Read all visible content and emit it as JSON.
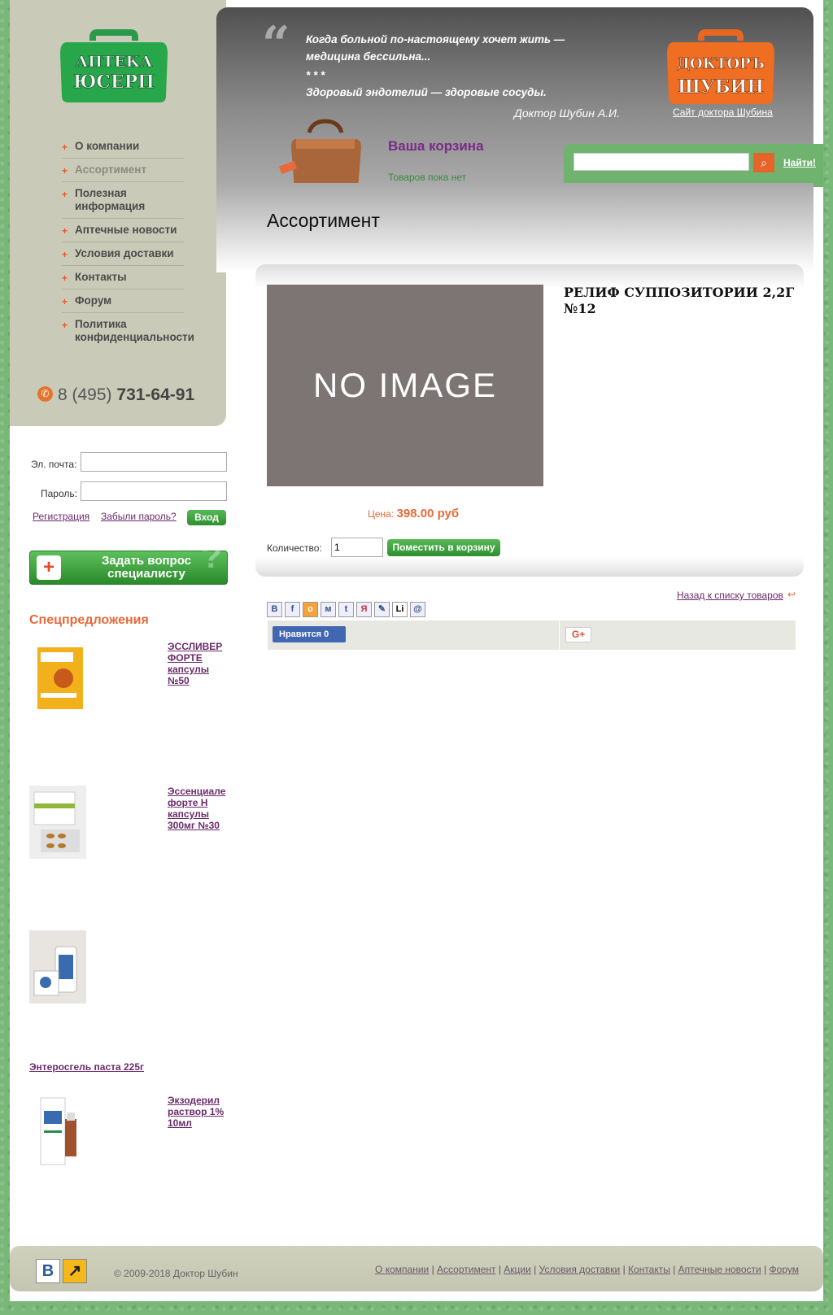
{
  "logo": {
    "line1": "АПТЕКА",
    "line2": "ЮСЕРП"
  },
  "nav": [
    {
      "label": "О компании",
      "active": false
    },
    {
      "label": "Ассортимент",
      "active": true
    },
    {
      "label": "Полезная информация",
      "active": false
    },
    {
      "label": "Аптечные новости",
      "active": false
    },
    {
      "label": "Условия доставки",
      "active": false
    },
    {
      "label": "Контакты",
      "active": false
    },
    {
      "label": "Форум",
      "active": false
    },
    {
      "label": "Политика конфиденциальности",
      "active": false
    }
  ],
  "phone": {
    "code": "8 (495)",
    "number": "731-64-91"
  },
  "login": {
    "email_label": "Эл. почта:",
    "password_label": "Пароль:",
    "register": "Регистрация",
    "forgot": "Забыли пароль?",
    "submit": "Вход"
  },
  "ask": {
    "label": "Задать вопрос специалисту"
  },
  "special": {
    "title": "Спецпредложения",
    "items": [
      {
        "name": "ЭССЛИВЕР ФОРТЕ капсулы №50"
      },
      {
        "name": "Эссенциале форте Н капсулы 300мг №30"
      },
      {
        "name": "Энтеросгель паста 225г"
      },
      {
        "name": "Экзодерил раствор 1% 10мл"
      }
    ]
  },
  "header": {
    "quote_line1": "Когда больной по-настоящему хочет жить — медицина бессильна...",
    "quote_sep": "* * *",
    "quote_line2": "Здоровый эндотелий — здоровые сосуды.",
    "author": "Доктор Шубин А.И.",
    "doc_logo1": "ДОКТОРЪ",
    "doc_logo2": "ШУБИН",
    "doc_link": "Сайт доктора Шубина"
  },
  "cart": {
    "title": "Ваша корзина",
    "status": "Товаров пока нет"
  },
  "search": {
    "button": "Найти!"
  },
  "page_title": "Ассортимент",
  "product": {
    "image_text": "NO IMAGE",
    "name": "РЕЛИФ СУППОЗИТОРИИ 2,2Г №12",
    "price_label": "Цена:",
    "price": "398.00 руб",
    "qty_label": "Количество:",
    "qty": "1",
    "add_button": "Поместить в корзину"
  },
  "back_link": "Назад к списку товаров",
  "share": [
    "В",
    "f",
    "о",
    "м",
    "t",
    "Я",
    "✎",
    "Li",
    "@"
  ],
  "social": {
    "fb": "Нравится 0",
    "gplus": "G+"
  },
  "footer": {
    "copyright": "© 2009-2018 Доктор Шубин",
    "links": [
      "О компании",
      "Ассортимент",
      "Акции",
      "Условия доставки",
      "Контакты",
      "Аптечные новости",
      "Форум"
    ],
    "icon_vk": "В",
    "icon_other": "↗"
  },
  "colors": {
    "accent": "#e6582a",
    "green": "#3a9a3a",
    "purple": "#7a2a8a"
  }
}
